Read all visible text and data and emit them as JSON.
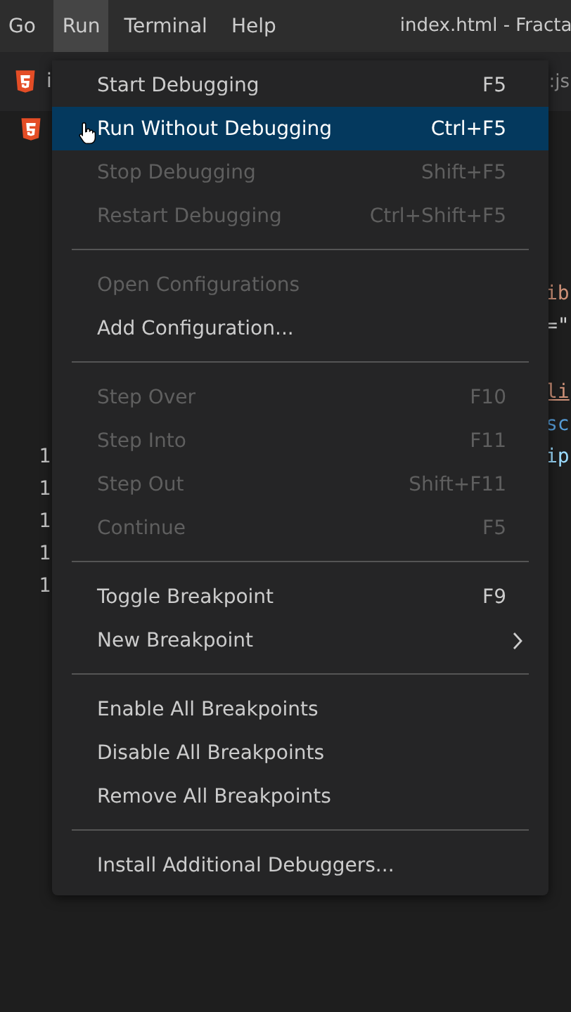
{
  "menubar": [
    {
      "label": "Go",
      "selected": false
    },
    {
      "label": "Run",
      "selected": true
    },
    {
      "label": "Terminal",
      "selected": false
    },
    {
      "label": "Help",
      "selected": false
    }
  ],
  "window": {
    "title": "index.html - Fracta"
  },
  "tabs": [
    {
      "label": "i"
    }
  ],
  "tab_row_fragment": ":js",
  "code_lines": [
    {
      "text": "ib",
      "color": "#ce9178"
    },
    {
      "text": "=\"",
      "color": "#d4d4d4"
    },
    {
      "kind": "blank"
    },
    {
      "text": "li",
      "color": "#ce9178",
      "underlined": true
    },
    {
      "text": "sc",
      "color": "#569cd6"
    },
    {
      "line_number": "1",
      "text": "ip",
      "color": "#9cdcfe"
    },
    {
      "line_number": "1"
    },
    {
      "line_number": "1"
    },
    {
      "line_number": "1"
    },
    {
      "line_number": "1"
    }
  ],
  "menu": [
    {
      "kind": "item",
      "label": "Start Debugging",
      "shortcut": "F5",
      "disabled": false,
      "selected": false
    },
    {
      "kind": "item",
      "label": "Run Without Debugging",
      "shortcut": "Ctrl+F5",
      "disabled": false,
      "selected": true
    },
    {
      "kind": "item",
      "label": "Stop Debugging",
      "shortcut": "Shift+F5",
      "disabled": true,
      "selected": false
    },
    {
      "kind": "item",
      "label": "Restart Debugging",
      "shortcut": "Ctrl+Shift+F5",
      "disabled": true,
      "selected": false
    },
    {
      "kind": "separator"
    },
    {
      "kind": "item",
      "label": "Open Configurations",
      "disabled": true,
      "selected": false
    },
    {
      "kind": "item",
      "label": "Add Configuration...",
      "disabled": false,
      "selected": false
    },
    {
      "kind": "separator"
    },
    {
      "kind": "item",
      "label": "Step Over",
      "shortcut": "F10",
      "disabled": true,
      "selected": false
    },
    {
      "kind": "item",
      "label": "Step Into",
      "shortcut": "F11",
      "disabled": true,
      "selected": false
    },
    {
      "kind": "item",
      "label": "Step Out",
      "shortcut": "Shift+F11",
      "disabled": true,
      "selected": false
    },
    {
      "kind": "item",
      "label": "Continue",
      "shortcut": "F5",
      "disabled": true,
      "selected": false
    },
    {
      "kind": "separator"
    },
    {
      "kind": "item",
      "label": "Toggle Breakpoint",
      "shortcut": "F9",
      "disabled": false,
      "selected": false
    },
    {
      "kind": "item",
      "label": "New Breakpoint",
      "submenu": true,
      "disabled": false,
      "selected": false
    },
    {
      "kind": "separator"
    },
    {
      "kind": "item",
      "label": "Enable All Breakpoints",
      "disabled": false,
      "selected": false
    },
    {
      "kind": "item",
      "label": "Disable All Breakpoints",
      "disabled": false,
      "selected": false
    },
    {
      "kind": "item",
      "label": "Remove All Breakpoints",
      "disabled": false,
      "selected": false
    },
    {
      "kind": "separator"
    },
    {
      "kind": "item",
      "label": "Install Additional Debuggers...",
      "disabled": false,
      "selected": false
    }
  ]
}
